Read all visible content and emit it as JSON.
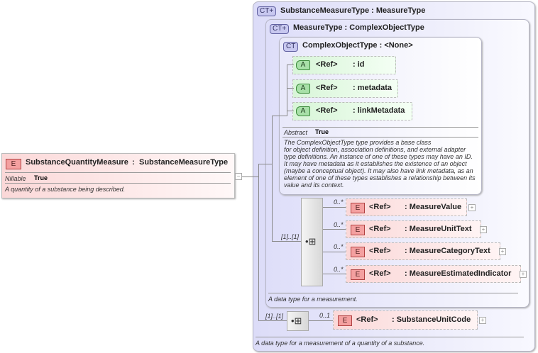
{
  "root_element": {
    "badge": "E",
    "name": "SubstanceQuantityMeasure",
    "type": "SubstanceMeasureType",
    "prop_label": "Nillable",
    "prop_value": "True",
    "description": "A quantity of a substance being described.",
    "collapse": "−"
  },
  "substance_measure_type": {
    "badge": "CT+",
    "title": "SubstanceMeasureType : MeasureType",
    "description": "A data type for a measurement of a quantity of a substance.",
    "sequence_cardinality": "[1]..[1]",
    "children": [
      {
        "cardinality": "0..1",
        "badge": "E",
        "ref": "<Ref>",
        "name": ": SubstanceUnitCode"
      }
    ]
  },
  "measure_type": {
    "badge": "CT+",
    "title": "MeasureType : ComplexObjectType",
    "description": "A data type for a measurement.",
    "sequence_cardinality": "[1]..[1]",
    "children": [
      {
        "cardinality": "0..*",
        "badge": "E",
        "ref": "<Ref>",
        "name": ": MeasureValue"
      },
      {
        "cardinality": "0..*",
        "badge": "E",
        "ref": "<Ref>",
        "name": ": MeasureUnitText"
      },
      {
        "cardinality": "0..*",
        "badge": "E",
        "ref": "<Ref>",
        "name": ": MeasureCategoryText"
      },
      {
        "cardinality": "0..*",
        "badge": "E",
        "ref": "<Ref>",
        "name": ": MeasureEstimatedIndicator"
      }
    ]
  },
  "complex_object_type": {
    "badge": "CT",
    "title": "ComplexObjectType : <None>",
    "prop_label": "Abstract",
    "prop_value": "True",
    "attributes": [
      {
        "badge": "A",
        "ref": "<Ref>",
        "name": ": id"
      },
      {
        "badge": "A",
        "ref": "<Ref>",
        "name": ": metadata"
      },
      {
        "badge": "A",
        "ref": "<Ref>",
        "name": ": linkMetadata"
      }
    ],
    "description_lines": [
      "The ComplexObjectType type provides a base class",
      "for object definition, association definitions, and external adapter",
      "type definitions. An instance of one of these types may have an ID.",
      "It may have metadata as it establishes the existence of an object",
      "(maybe a conceptual object). It may also have link metadata, as an",
      "element of one of these types establishes a relationship between its",
      "value and its context."
    ]
  },
  "expand_symbol": "+"
}
